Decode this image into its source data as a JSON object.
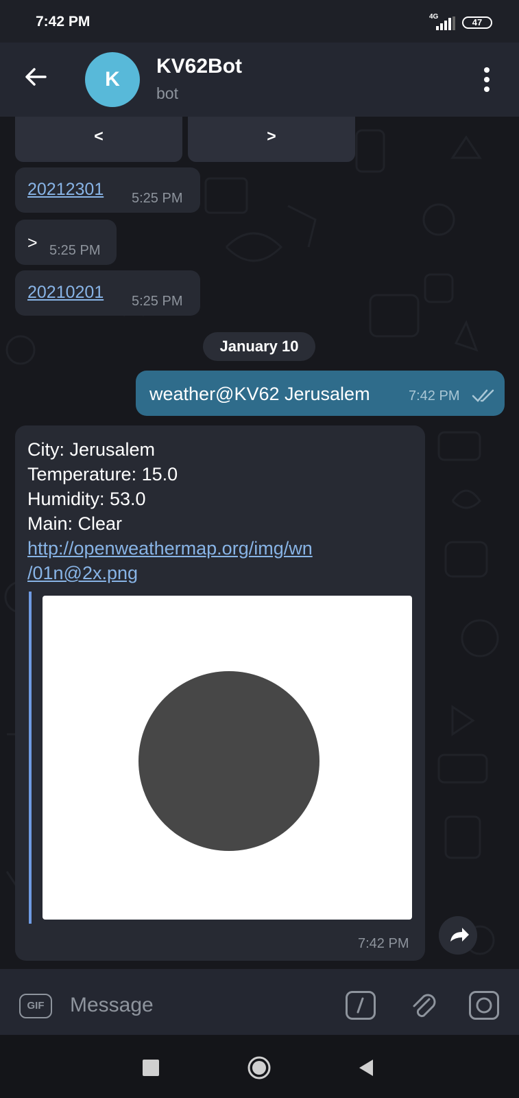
{
  "status": {
    "time": "7:42 PM",
    "network": "4G",
    "battery": "47"
  },
  "header": {
    "avatar_letter": "K",
    "title": "KV62Bot",
    "subtitle": "bot"
  },
  "keyboard": {
    "prev_label": "<",
    "next_label": ">"
  },
  "messages": [
    {
      "text": "20212301",
      "time": "5:25 PM"
    },
    {
      "text": ">",
      "time": "5:25 PM"
    },
    {
      "text": "20210201",
      "time": "5:25 PM"
    }
  ],
  "date_separator": "January 10",
  "outgoing": {
    "text": "weather@KV62 Jerusalem",
    "time": "7:42 PM"
  },
  "weather": {
    "city": "City: Jerusalem",
    "temperature": "Temperature: 15.0",
    "humidity": "Humidity: 53.0",
    "main": "Main: Clear",
    "link_line1": "http://openweathermap.org/img/wn",
    "link_line2": "/01n@2x.png",
    "time": "7:42 PM"
  },
  "composer": {
    "gif_label": "GIF",
    "placeholder": "Message"
  },
  "icons": {
    "back": "arrow-left",
    "more": "vertical-dots",
    "share": "share-arrow",
    "command": "slash-box",
    "attach": "paperclip",
    "camera": "camera",
    "nav_recent": "square",
    "nav_home": "circle",
    "nav_back": "triangle"
  },
  "colors": {
    "background": "#17181d",
    "header": "#242731",
    "bubble_in": "#272a33",
    "bubble_out": "#2f6c8b",
    "link": "#88b4e6",
    "avatar": "#58b9d9"
  }
}
